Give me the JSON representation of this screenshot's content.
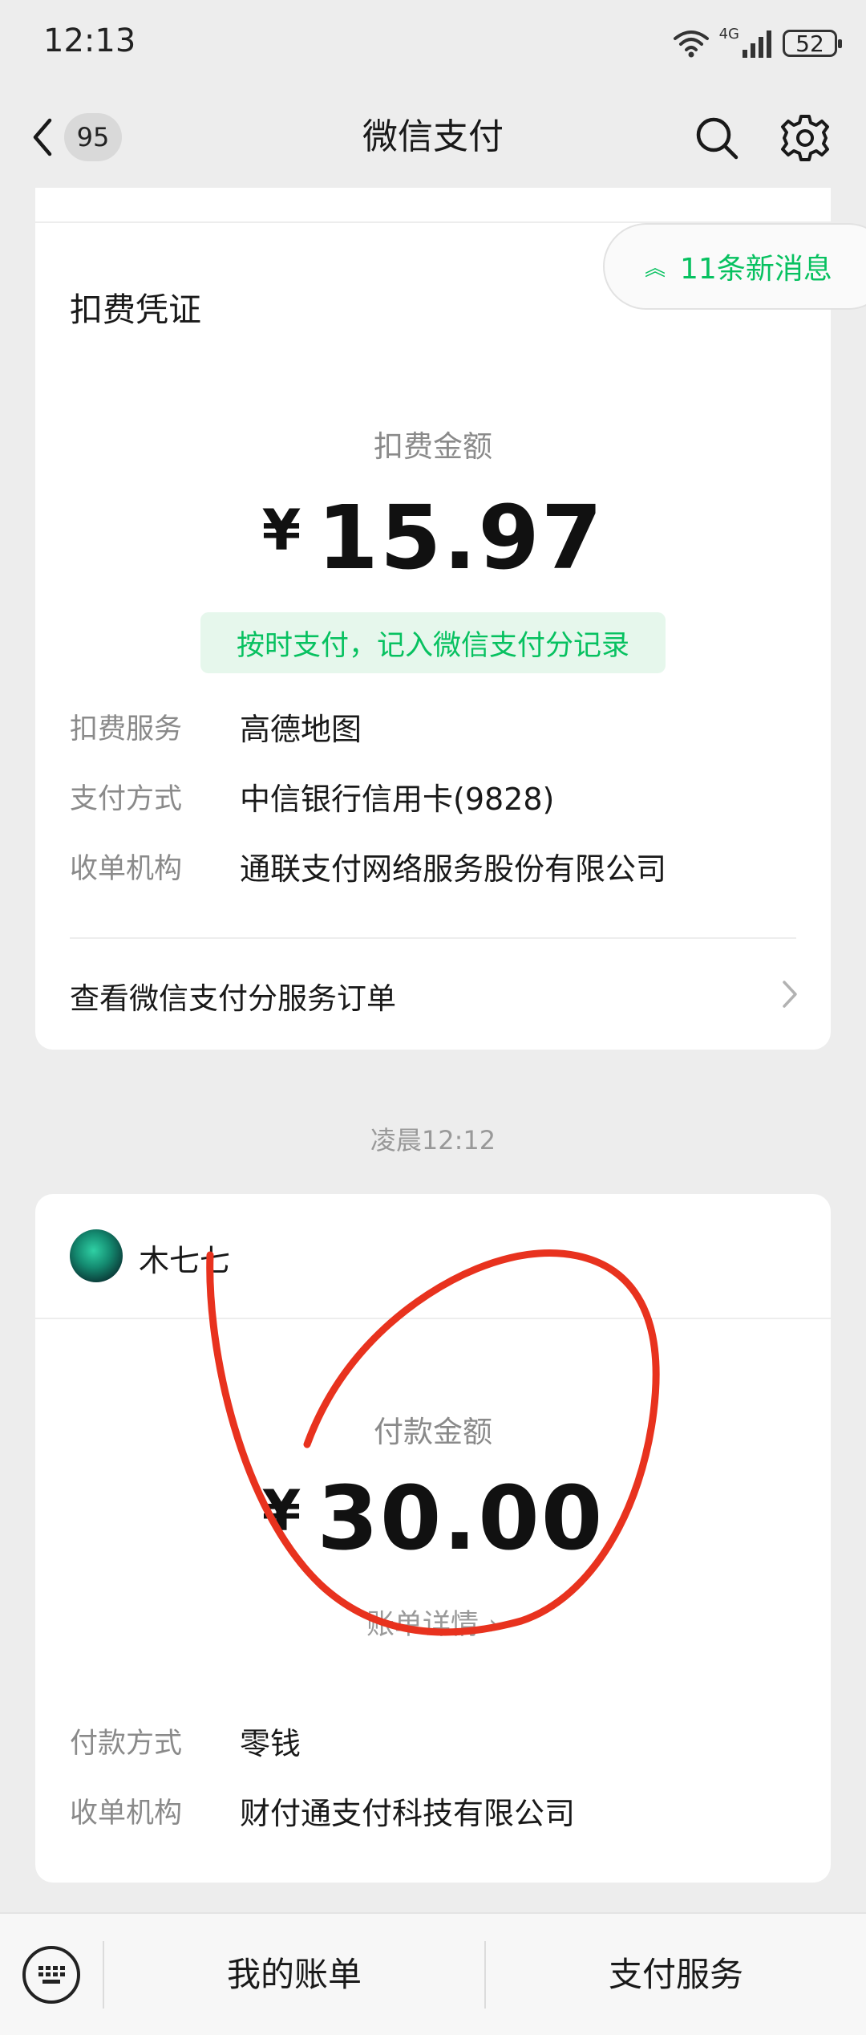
{
  "status_bar": {
    "time": "12:13",
    "network": "4G",
    "battery": "52"
  },
  "nav": {
    "unread_count": "95",
    "title": "微信支付"
  },
  "new_messages": {
    "label": "11条新消息"
  },
  "deduction_card": {
    "title": "扣费凭证",
    "amount_label": "扣费金额",
    "currency": "¥",
    "amount": "15.97",
    "tag": "按时支付，记入微信支付分记录",
    "rows": [
      {
        "label": "扣费服务",
        "value": "高德地图"
      },
      {
        "label": "支付方式",
        "value": "中信银行信用卡(9828)"
      },
      {
        "label": "收单机构",
        "value": "通联支付网络服务股份有限公司"
      }
    ],
    "link": "查看微信支付分服务订单"
  },
  "timestamp": "凌晨12:12",
  "payment_card": {
    "payee": "木七七",
    "amount_label": "付款金额",
    "currency": "¥",
    "amount": "30.00",
    "details_link": "账单详情",
    "rows": [
      {
        "label": "付款方式",
        "value": "零钱"
      },
      {
        "label": "收单机构",
        "value": "财付通支付科技有限公司"
      }
    ]
  },
  "bottom_bar": {
    "items": [
      "我的账单",
      "支付服务"
    ]
  },
  "colors": {
    "wechat_green": "#07c160",
    "annotation_red": "#e8321e"
  }
}
